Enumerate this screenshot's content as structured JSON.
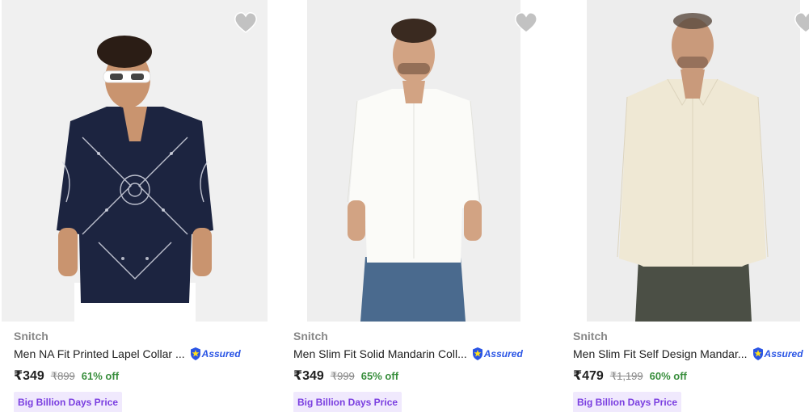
{
  "products": [
    {
      "brand": "Snitch",
      "title": "Men NA Fit Printed Lapel Collar ...",
      "assured_label": "Assured",
      "price": "₹349",
      "mrp": "₹899",
      "discount": "61% off",
      "deal_badge": "Big Billion Days Price",
      "image": "model-in-navy-bandana-print-shirt",
      "wishlist_icon": "heart-icon"
    },
    {
      "brand": "Snitch",
      "title": "Men Slim Fit Solid Mandarin Coll...",
      "assured_label": "Assured",
      "price": "₹349",
      "mrp": "₹999",
      "discount": "65% off",
      "deal_badge": "Big Billion Days Price",
      "image": "model-in-white-mandarin-shirt",
      "wishlist_icon": "heart-icon"
    },
    {
      "brand": "Snitch",
      "title": "Men Slim Fit Self Design Mandar...",
      "assured_label": "Assured",
      "price": "₹479",
      "mrp": "₹1,199",
      "discount": "60% off",
      "deal_badge": "Big Billion Days Price",
      "image": "model-in-cream-textured-shirt",
      "wishlist_icon": "heart-icon"
    }
  ],
  "colors": {
    "discount": "#388e3c",
    "assured": "#2a55e5",
    "deal_badge_bg": "#f0e9fd",
    "deal_badge_text": "#7a3ee0",
    "wishlist": "#c2c2c2"
  }
}
